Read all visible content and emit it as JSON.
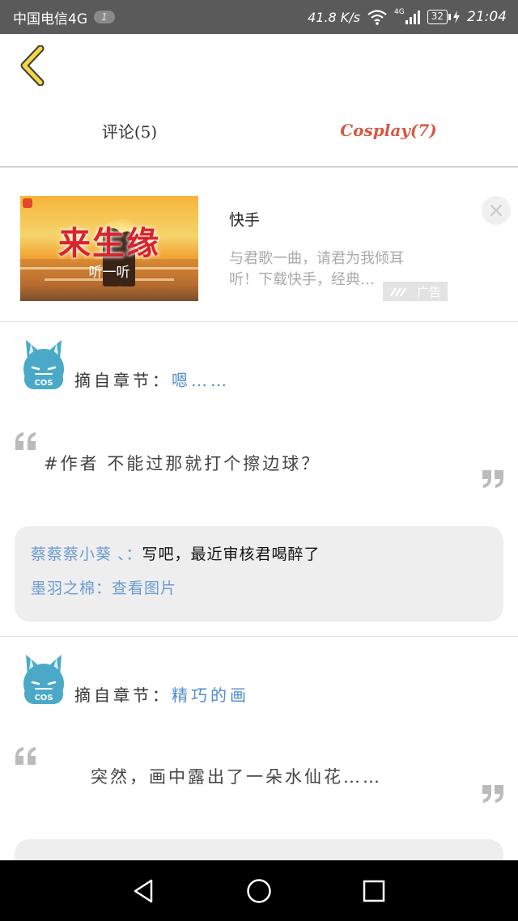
{
  "status_bar": {
    "carrier": "中国电信4G",
    "badge": "1",
    "speed": "41.8 K/s",
    "network": "4G",
    "battery": "32",
    "time": "21:04"
  },
  "tabs": [
    {
      "label": "评论(5)"
    },
    {
      "label": "Cosplay(7)"
    }
  ],
  "colors": {
    "accent": "#d45a45",
    "link": "#4f8ccf",
    "status_bar": "#5a5a5a"
  },
  "ad": {
    "image_title": "来生缘",
    "image_subtitle": "听一听",
    "name": "快手",
    "description": "与君歌一曲，请君为我倾耳听！下载快手，经典…",
    "badge": "广告"
  },
  "cards": [
    {
      "chapter_prefix": "摘自章节：",
      "chapter_name": "嗯……",
      "quote": "#作者 不能过那就打个擦边球？",
      "replies": [
        {
          "user": "蔡蔡蔡小葵 、：",
          "text": "写吧，最近审核君喝醉了"
        },
        {
          "user": "墨羽之棉：",
          "link": "查看图片"
        }
      ]
    },
    {
      "chapter_prefix": "摘自章节：",
      "chapter_name": "精巧的画",
      "quote": "突然，画中露出了一朵水仙花……"
    }
  ],
  "icons": [
    "back-icon",
    "wifi-icon",
    "signal-icon",
    "battery-icon",
    "close-icon",
    "avatar-icon",
    "quote-open-icon",
    "quote-close-icon",
    "nav-back-icon",
    "nav-home-icon",
    "nav-recents-icon"
  ]
}
